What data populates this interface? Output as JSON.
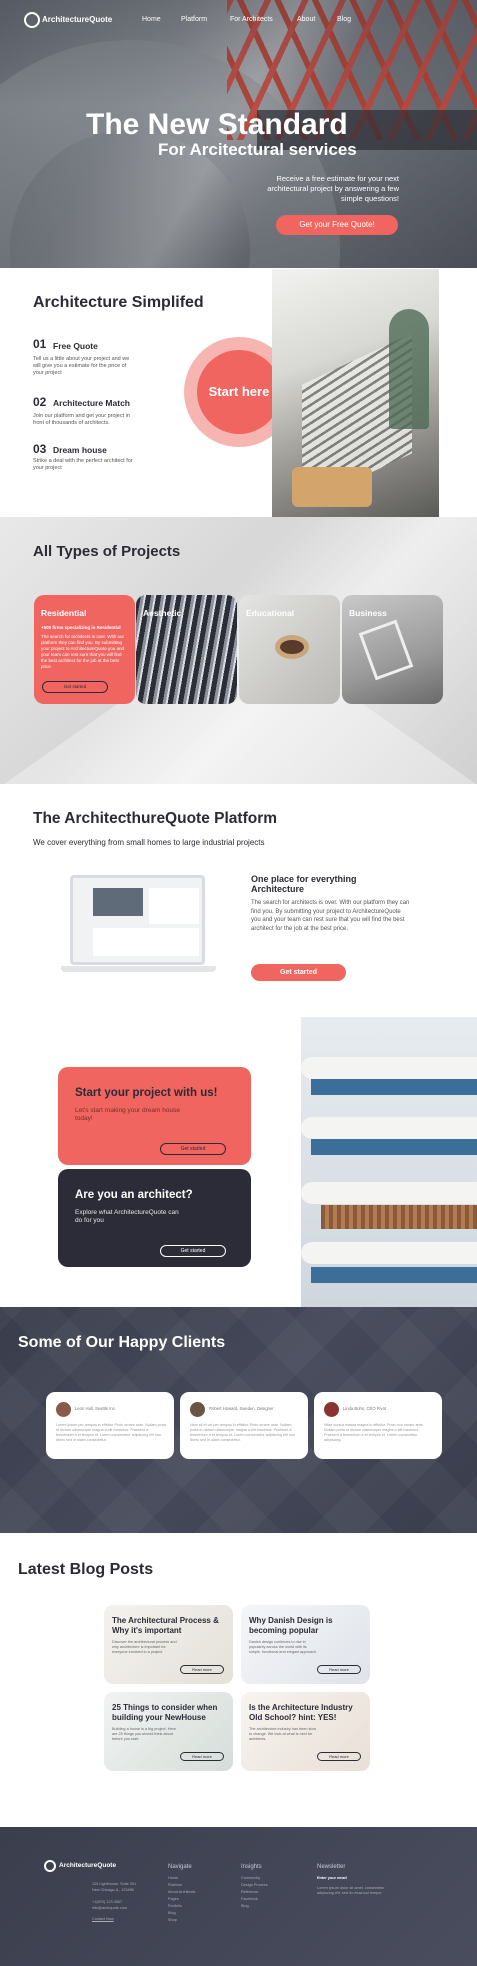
{
  "nav": {
    "brand": "ArchitectureQuote",
    "links": [
      "Home",
      "Platform",
      "For Architects",
      "About",
      "Blog"
    ]
  },
  "hero": {
    "title": "The New Standard",
    "subtitle": "For Arcitectural services",
    "description": "Receive a free estimate for your next architectural project by answering a few simple questions!",
    "cta": "Get your Free Quote!"
  },
  "simplified": {
    "title": "Architecture Simplifed",
    "steps": [
      {
        "num": "01",
        "title": "Free Quote",
        "desc": "Tell us a little about your project and we will give you a estimate for the price of your project"
      },
      {
        "num": "02",
        "title": "Architecture Match",
        "desc": "Join our platform and get your project in front of thousands of architects."
      },
      {
        "num": "03",
        "title": "Dream house",
        "desc": "Strike a deal with the perfect architect for your project"
      }
    ],
    "start_label": "Start here"
  },
  "projects": {
    "title": "All Types of Projects",
    "cards": [
      {
        "label": "Residential",
        "highlight": "+500 firms specializing in Residential",
        "text": "The search for architects is over. With our platform they can find you. By submitting your project to ArchitectureQuote you and your team can rest sure that you will find the best architect for the job at the best price.",
        "button": "Get started"
      },
      {
        "label": "Aesthetic"
      },
      {
        "label": "Educational"
      },
      {
        "label": "Business"
      }
    ]
  },
  "platform": {
    "title": "The ArchitecthureQuote Platform",
    "subtitle": "We cover everything from small homes to large industrial projects",
    "right_title": "One place for everything Architecture",
    "right_desc": "The search for architects is over. With our platform they can find you. By submitting your project to ArchitectureQuote you and your team can rest sure that you will find the best architect for the job at the best price.",
    "button": "Get started"
  },
  "cta": {
    "start": {
      "title": "Start your project with us!",
      "desc": "Let's start making your dream house today!",
      "button": "Get started"
    },
    "architect": {
      "title": "Are you an architect?",
      "desc": "Explore what ArchitectureQuote can do for you",
      "button": "Get started"
    }
  },
  "clients": {
    "title": "Some of Our Happy Clients",
    "items": [
      {
        "name": "Leon Hall, Seattle Inc.",
        "text": "Lorem ipsum per tempus in efficitur Proin ornare ante. Nullam porta et dictum ullamcorper magna a elit maximus. Praesent a fermentum a et tempus et. Lorem consectetur adipiscing elit non libero sed in ullam consectetur."
      },
      {
        "name": "Robert Howard, Sweden, Designer",
        "text": "Nam sit et vel per tempus in efficitur Proin ornare ante. Nullam porta et dictum ullamcorper magna a elit maximus. Praesent a fermentum a et tempus et. Lorem consectetur adipiscing elit non libero sed in ullam consectetur."
      },
      {
        "name": "Linda Bohn, CEO Pivot",
        "text": "Vitae cursus massa magna in efficitur. Proin non ornare ante. Nullam porta et dictum ullamcorper magna a elit maximus. Praesent a fermentum a et tempus et. Lorem consectetur adipiscing."
      }
    ]
  },
  "blog": {
    "title": "Latest Blog Posts",
    "posts": [
      {
        "title": "The Architectural Process & Why it's important",
        "text": "Discover the architectural process and why architecture is important for everyone involved in a project.",
        "button": "Read more"
      },
      {
        "title": "Why Danish Design is becoming popular",
        "text": "Danish design continues to rise in popularity across the world with its simple, functional and elegant approach.",
        "button": "Read more"
      },
      {
        "title": "25 Things to consider when building your NewHouse",
        "text": "Building a house is a big project. Here are 25 things you should think about before you start.",
        "button": "Read more"
      },
      {
        "title": "Is the Architecture Industry Old School? hint: YES!",
        "text": "The architecture industry has been slow to change. We look at what is next for architects.",
        "button": "Read more"
      }
    ]
  },
  "footer": {
    "brand": "ArchitectureQuote",
    "address": [
      "125 Lighthouse, Suite 201",
      "New Chicago-IL, 123456"
    ],
    "contact": [
      "+1(870) 123 4567",
      "info@archquote.com"
    ],
    "link": "Contact Now",
    "columns": [
      {
        "heading": "Navigate",
        "items": [
          "Home",
          "Platform",
          "About Architects",
          "Pages",
          "Portfolio",
          "Blog",
          "Shop"
        ]
      },
      {
        "heading": "Insights",
        "items": [
          "Community",
          "Design Process",
          "Reference",
          "Facebook",
          "Blog"
        ]
      },
      {
        "heading": "Newsletter",
        "items": [
          "Enter your email",
          "Lorem ipsum dolor sit amet, consectetur adipiscing elit, sed do eiusmod tempor."
        ]
      }
    ]
  },
  "colors": {
    "accent": "#f0655f",
    "dark": "#2c2c39",
    "footer": "#3b3e4d"
  }
}
